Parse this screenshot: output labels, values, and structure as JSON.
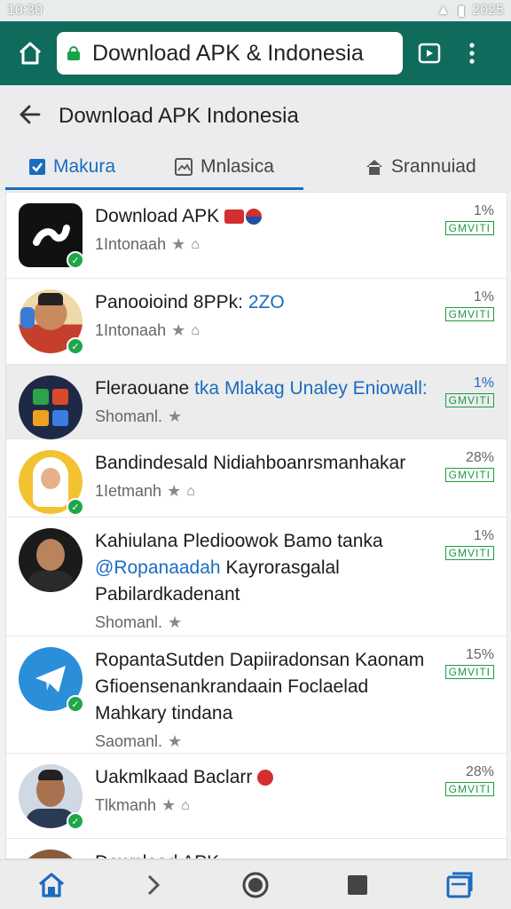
{
  "status_bar": {
    "time": "10:30",
    "year": "2025"
  },
  "browser": {
    "url_text": "Download APK & Indonesia"
  },
  "page": {
    "title": "Download APK Indonesia"
  },
  "tabs": [
    {
      "label": "Makura",
      "active": true
    },
    {
      "label": "Mnlasica",
      "active": false
    },
    {
      "label": "Srannuiad",
      "active": false
    }
  ],
  "apps": [
    {
      "name": "Download APK",
      "name_blue": "",
      "sub": "1Intonaah",
      "size": "1%",
      "tag": "GMVITI",
      "avatar": "app-logo",
      "highlight": false
    },
    {
      "name": "Panooioind 8PPk:",
      "name_blue": "2ZO",
      "sub": "1Intonaah",
      "size": "1%",
      "tag": "GMVITI",
      "avatar": "man-cap",
      "highlight": false
    },
    {
      "name": "Fleraouane",
      "name_blue": "tka Mlakag Unaley Eniowall:",
      "sub": "Shomanl.",
      "size": "1%",
      "tag": "GMVITI",
      "avatar": "grid-logo",
      "highlight": true
    },
    {
      "name": "Bandindesald Nidiahboanrsmanhakar",
      "name_blue": "",
      "sub": "1Ietmanh",
      "size": "28%",
      "tag": "GMVITI",
      "avatar": "woman-hijab",
      "highlight": false
    },
    {
      "name": "Kahiulana Pledioowok Bamo tanka",
      "name2_blue": "@Ropanaadah",
      "name2": "Kayrorasgalal",
      "name3": "Pabilardkadenant",
      "sub": "Shomanl.",
      "size": "1%",
      "tag": "GMVITI",
      "avatar": "man-suit",
      "highlight": false
    },
    {
      "name": "RopantaSutden Dapiiradonsan Kaonam",
      "name2": "Gfioensenankrandaain Foclaelad",
      "name3": "Mahkary",
      "name3b": "tindana",
      "sub": "Saomanl.",
      "size": "15%",
      "tag": "GMVITI",
      "avatar": "telegram",
      "highlight": false
    },
    {
      "name": "Uakmlkaad Baclarr",
      "sub": "Tlkmanh",
      "size": "28%",
      "tag": "GMVITI",
      "avatar": "man-shirt",
      "highlight": false
    },
    {
      "name": "Download APK",
      "sub": "",
      "size": "",
      "tag": "",
      "avatar": "partial",
      "highlight": false
    }
  ]
}
